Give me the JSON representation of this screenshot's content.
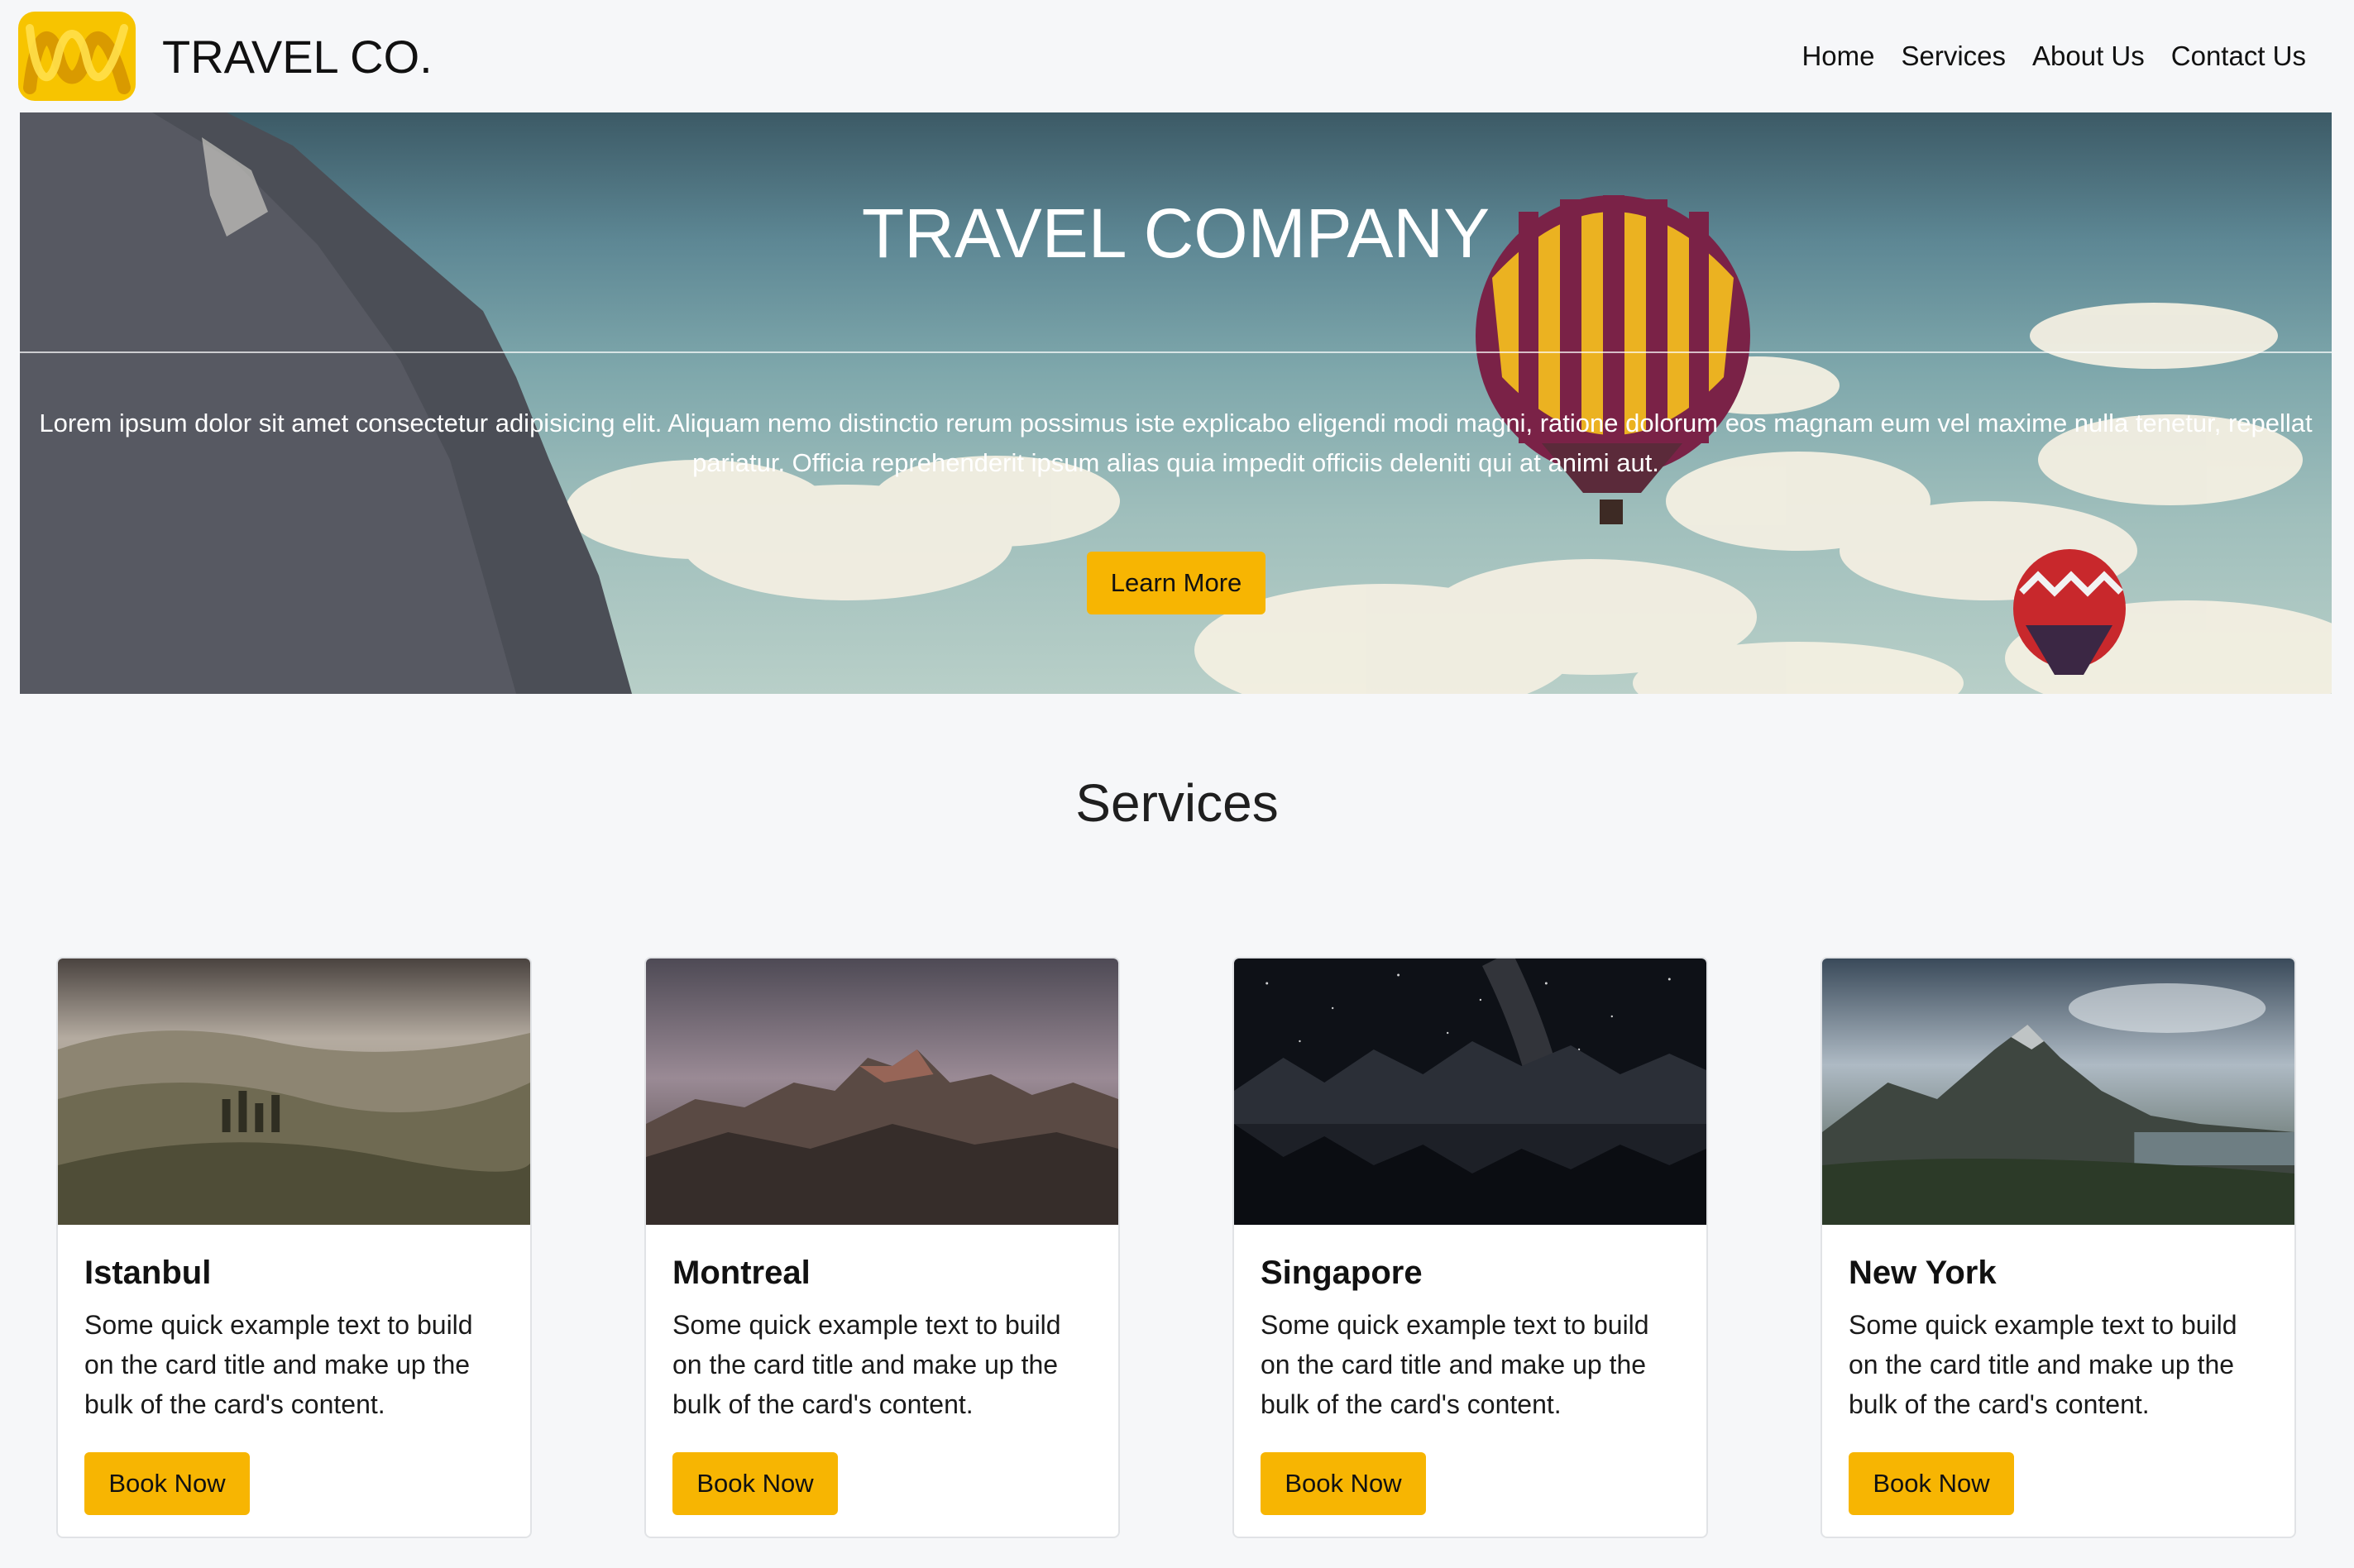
{
  "brand": {
    "name": "TRAVEL CO.",
    "logo_icon": "abc-ribbon-logo-icon",
    "accent_color": "#f7b502"
  },
  "nav": {
    "items": [
      {
        "label": "Home"
      },
      {
        "label": "Services"
      },
      {
        "label": "About Us"
      },
      {
        "label": "Contact Us"
      }
    ]
  },
  "hero": {
    "title": "TRAVEL COMPANY",
    "text": "Lorem ipsum dolor sit amet consectetur adipisicing elit. Aliquam nemo distinctio rerum possimus iste explicabo eligendi modi magni, ratione dolorum eos magnam eum vel maxime nulla tenetur, repellat pariatur. Officia reprehenderit ipsum alias quia impedit officiis deleniti qui at animi aut.",
    "button_label": "Learn More"
  },
  "services": {
    "title": "Services",
    "cards": [
      {
        "title": "Istanbul",
        "text": "Some quick example text to build on the card title and make up the bulk of the card's content.",
        "button_label": "Book Now"
      },
      {
        "title": "Montreal",
        "text": "Some quick example text to build on the card title and make up the bulk of the card's content.",
        "button_label": "Book Now"
      },
      {
        "title": "Singapore",
        "text": "Some quick example text to build on the card title and make up the bulk of the card's content.",
        "button_label": "Book Now"
      },
      {
        "title": "New York",
        "text": "Some quick example text to build on the card title and make up the bulk of the card's content.",
        "button_label": "Book Now"
      }
    ]
  }
}
